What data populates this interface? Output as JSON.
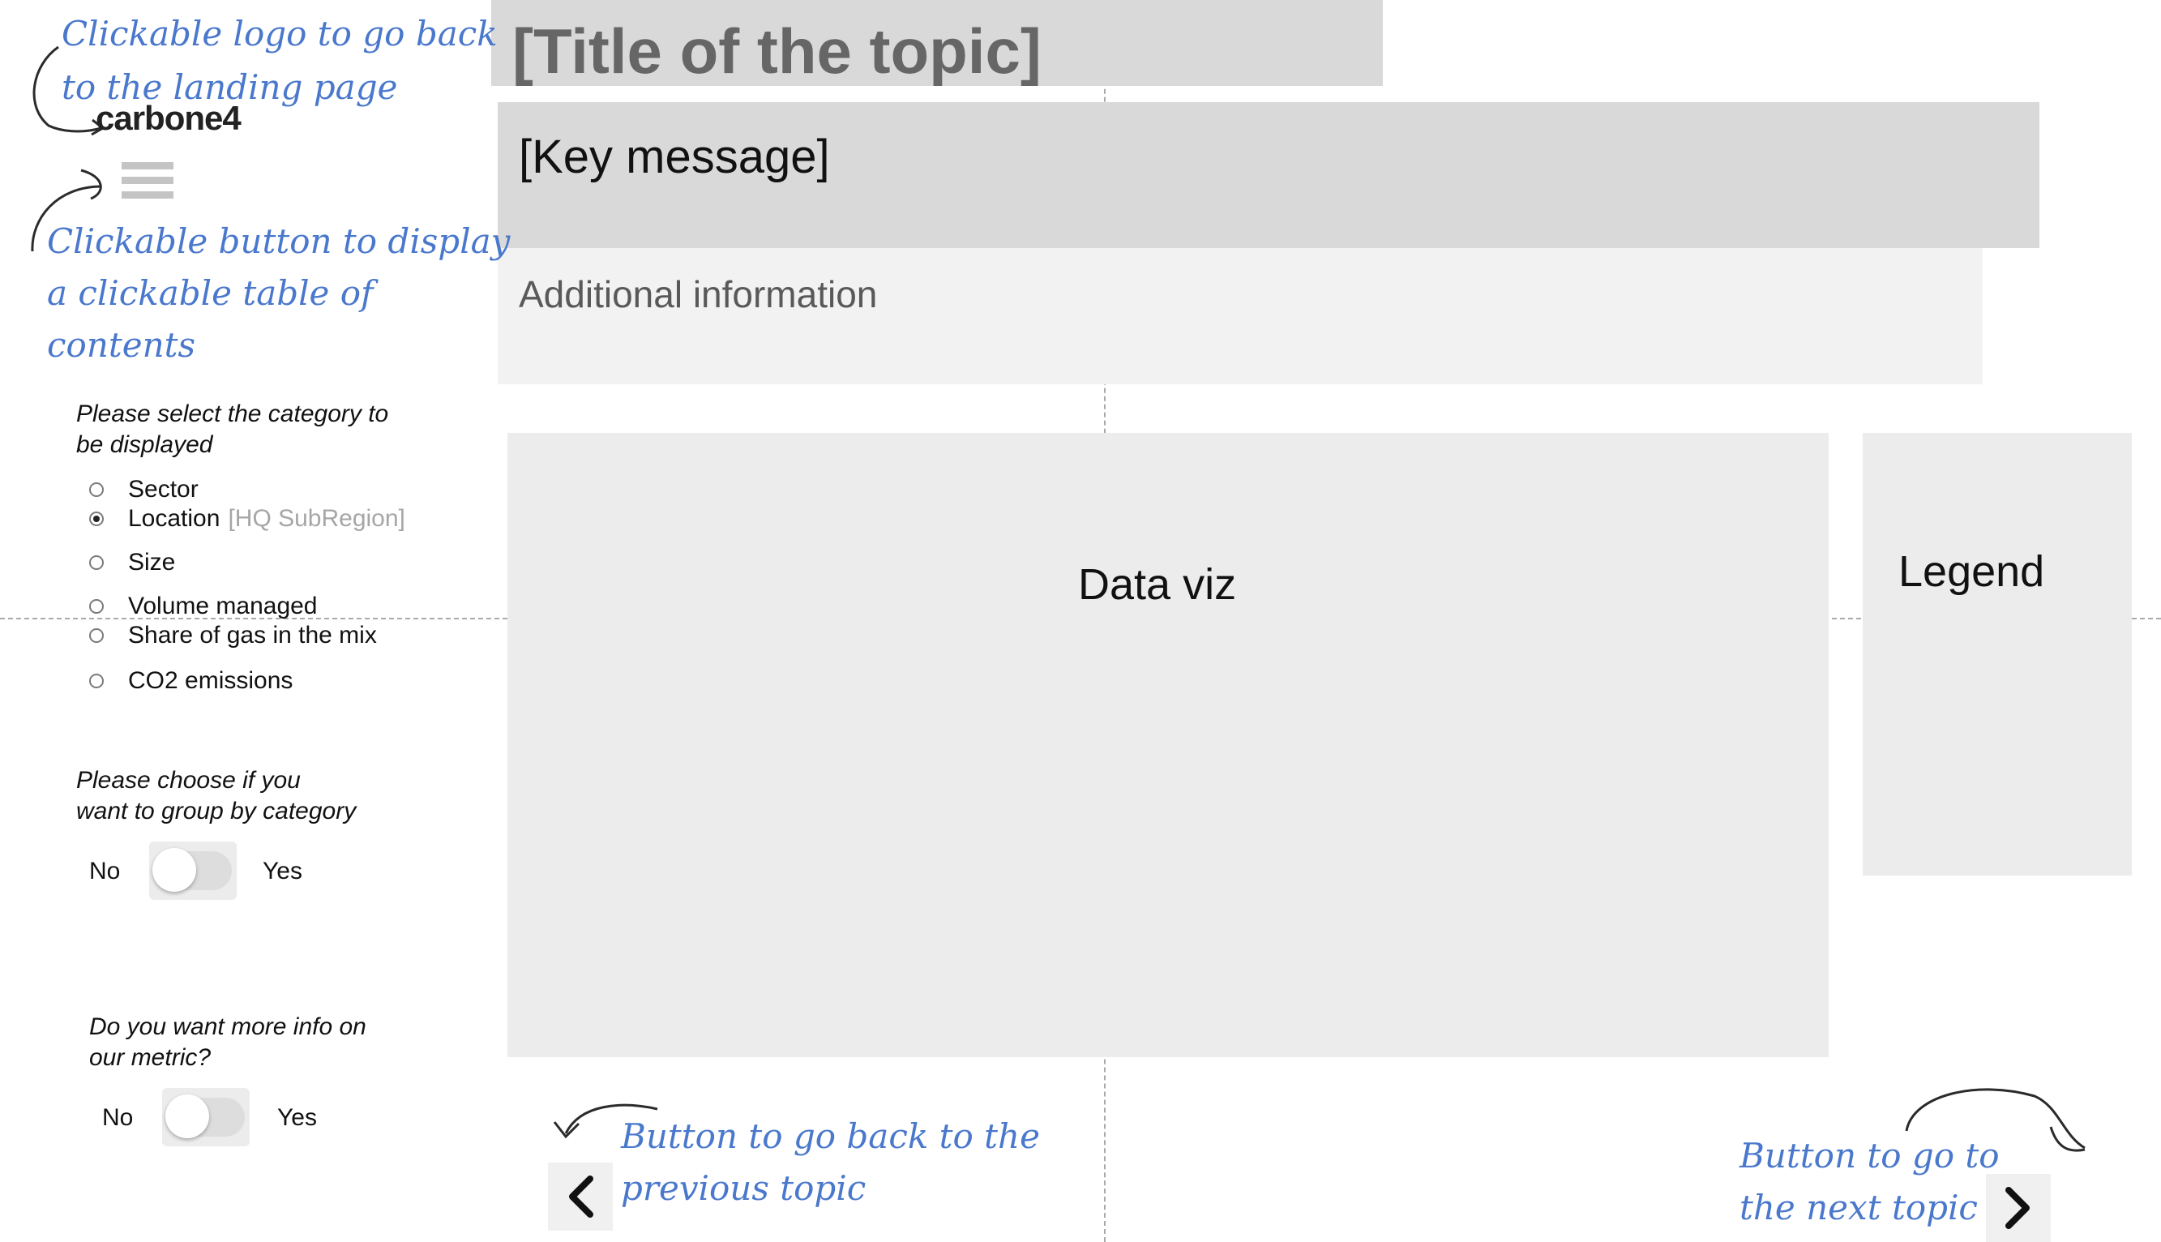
{
  "header": {
    "title": "[Title of the topic]",
    "key_message": "[Key message]",
    "additional_info": "Additional information"
  },
  "sidebar": {
    "logo_text": "carbone4",
    "menu_icon": "hamburger-icon",
    "category_prompt_line1": "Please select the category to",
    "category_prompt_line2": "be displayed",
    "categories": [
      {
        "label": "Sector",
        "hint": "",
        "checked": false
      },
      {
        "label": "Location",
        "hint": "[HQ SubRegion]",
        "checked": true
      },
      {
        "label": "Size",
        "hint": "",
        "checked": false
      },
      {
        "label": "Volume managed",
        "hint": "",
        "checked": false
      },
      {
        "label": "Share of gas in the mix",
        "hint": "",
        "checked": false
      },
      {
        "label": "CO2 emissions",
        "hint": "",
        "checked": false
      }
    ],
    "group_prompt_line1": "Please choose if you",
    "group_prompt_line2": "want to group by category",
    "group_toggle": {
      "no": "No",
      "yes": "Yes",
      "on": false
    },
    "metric_prompt_line1": "Do you want more info on",
    "metric_prompt_line2": "our metric?",
    "metric_toggle": {
      "no": "No",
      "yes": "Yes",
      "on": false
    }
  },
  "main": {
    "dataviz_label": "Data viz",
    "legend_label": "Legend"
  },
  "annotations": {
    "logo_line1": "Clickable logo to go back",
    "logo_line2": "to the landing page",
    "menu_line1": "Clickable button to display",
    "menu_line2": "a clickable table of",
    "menu_line3": "contents",
    "prev_line1": "Button to go back to the",
    "prev_line2": "previous topic",
    "next_line1": "Button to go to",
    "next_line2": "the next topic"
  },
  "colors": {
    "annotation": "#4a78cc",
    "header_box": "#d9d9d9",
    "info_box": "#f2f2f2",
    "panel": "#ececec"
  }
}
